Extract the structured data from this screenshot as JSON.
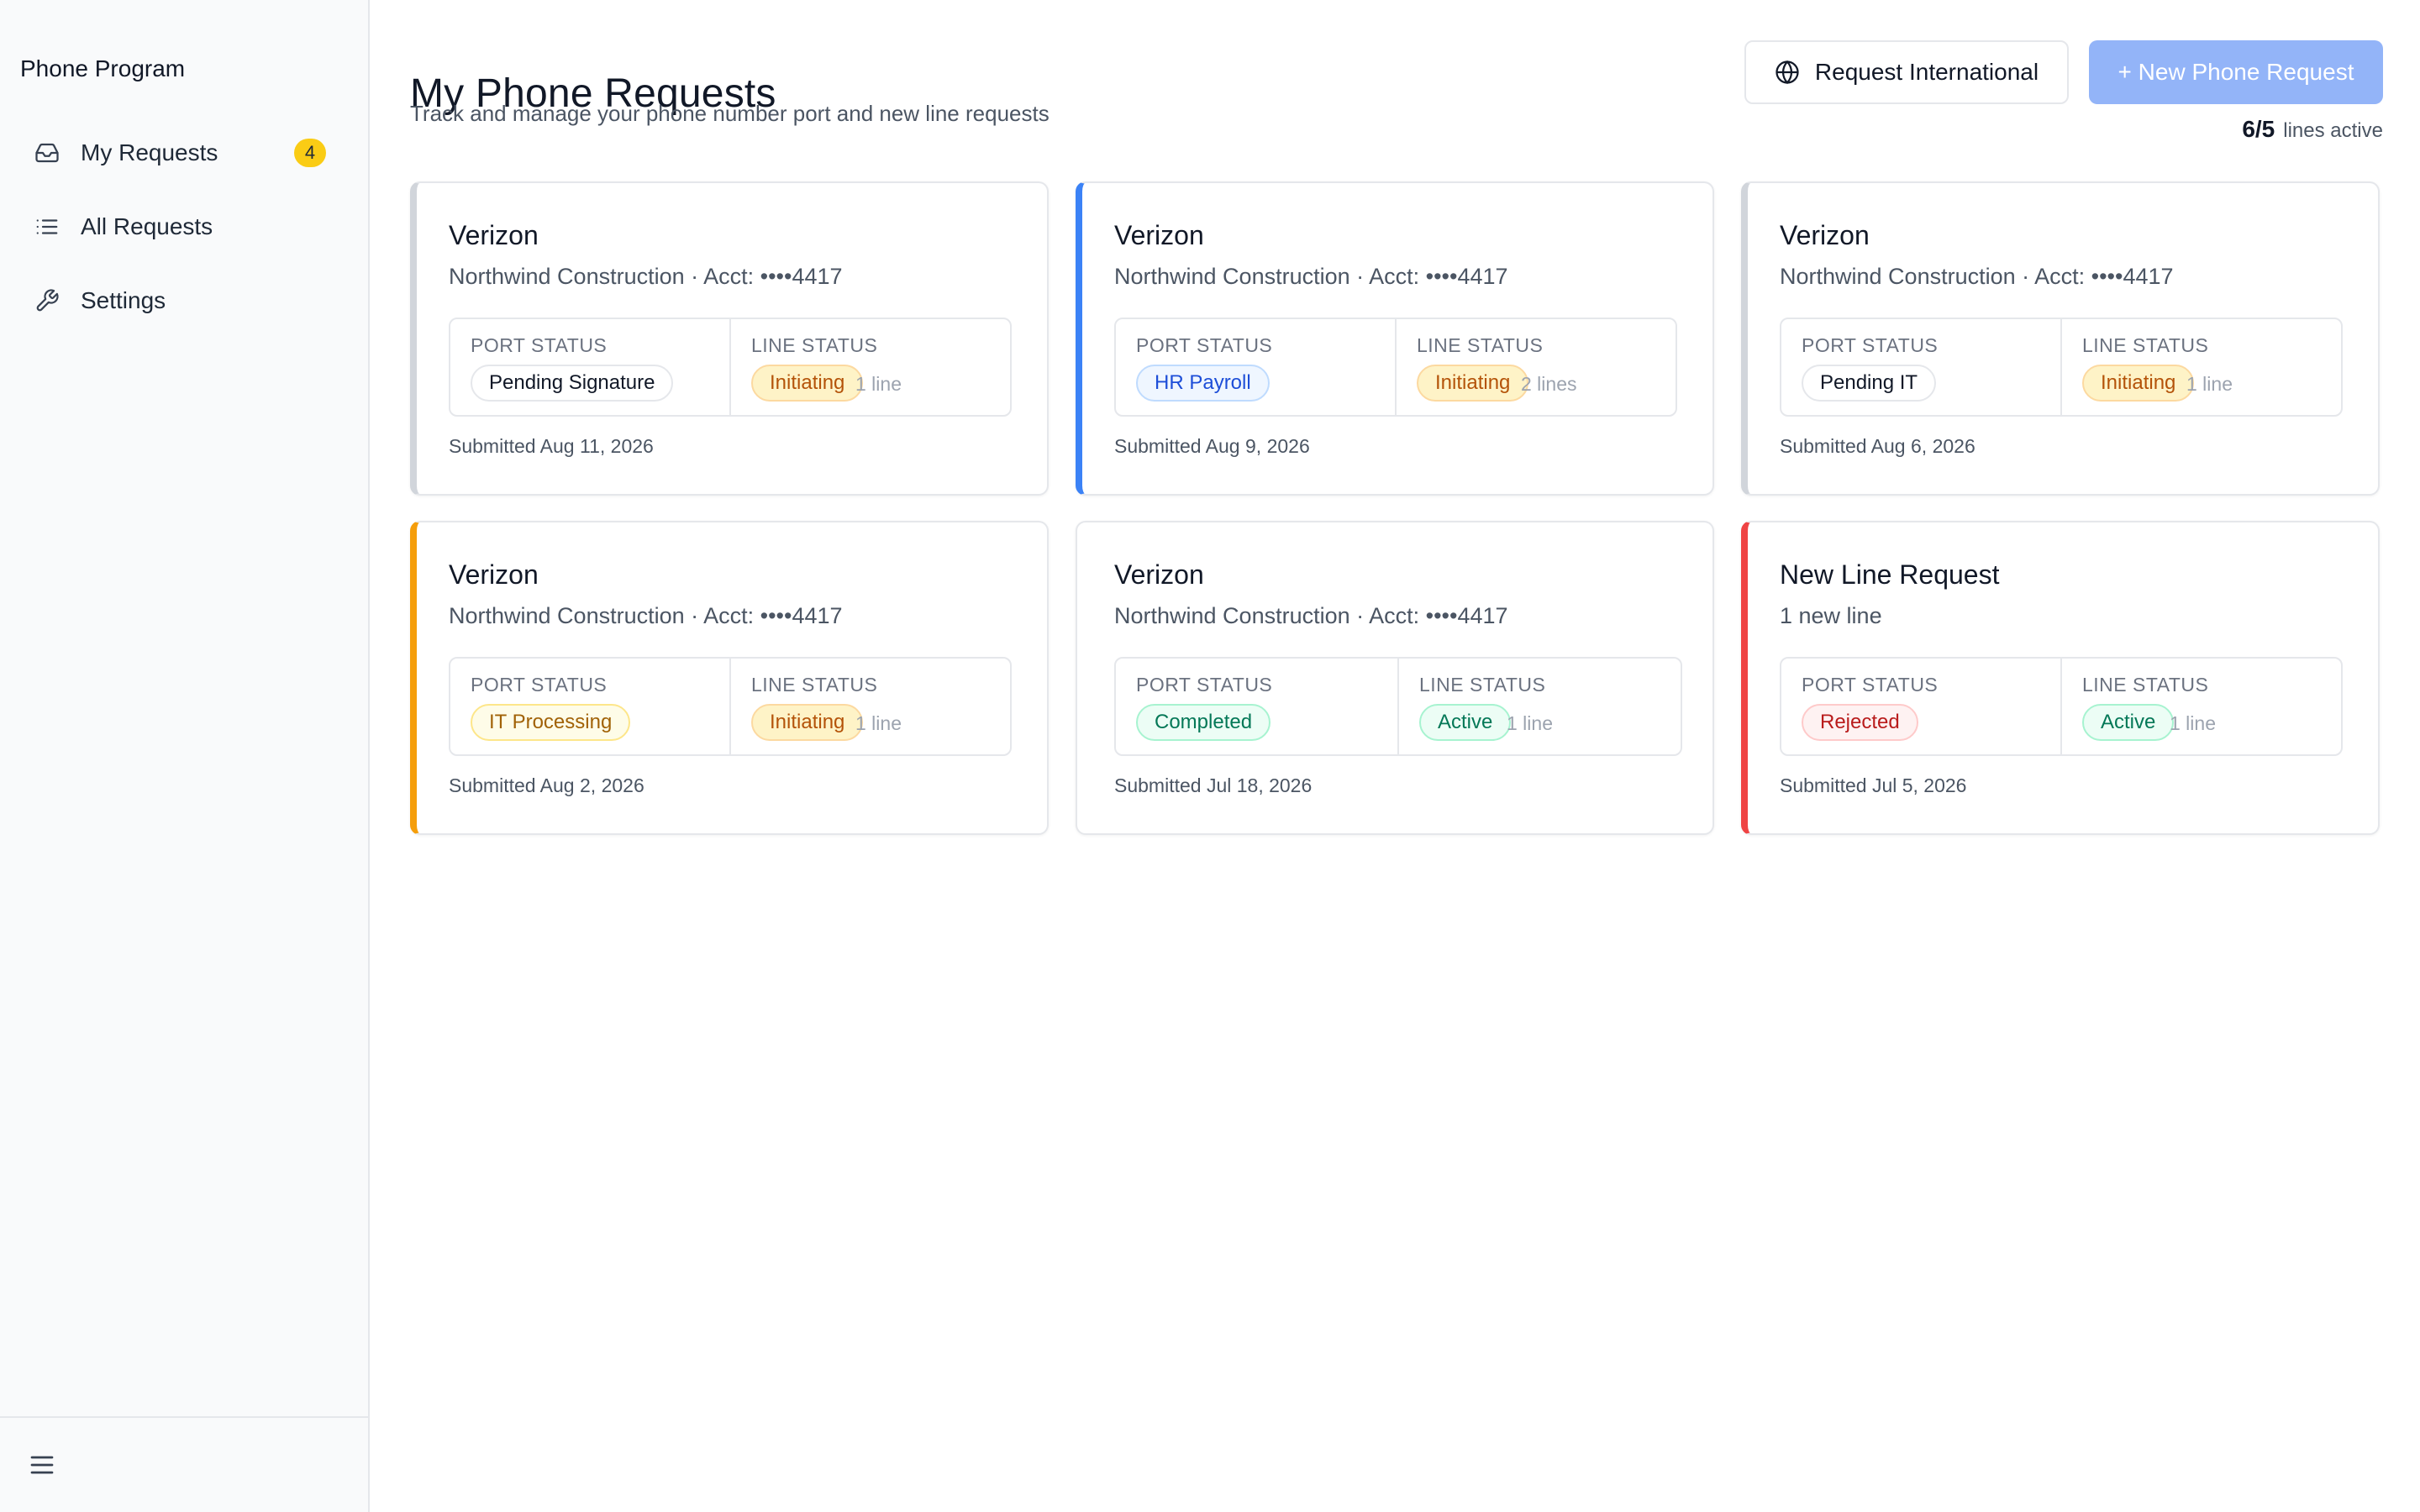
{
  "app": {
    "brand": "Phone Program"
  },
  "sidebar": {
    "items": [
      {
        "label": "My Requests",
        "icon": "inbox-icon",
        "badge": "4"
      },
      {
        "label": "All Requests",
        "icon": "list-icon"
      },
      {
        "label": "Settings",
        "icon": "wrench-icon"
      }
    ],
    "footer_icon": "hamburger-menu-icon"
  },
  "header": {
    "title": "My Phone Requests",
    "subtitle": "Track and manage your phone number port and new line requests",
    "intl_button": "Request International",
    "new_button": "+ New Phone Request",
    "lines_count": "6/5",
    "lines_label": "lines active"
  },
  "labels": {
    "port_status": "PORT STATUS",
    "line_status": "LINE STATUS"
  },
  "colors": {
    "accent_blue": "#3b82f6",
    "accent_orange": "#f59e0b",
    "accent_red": "#ef4444",
    "accent_gray": "#d1d5db",
    "badge_yellow": "#facc15",
    "primary_button": "#93b4f8"
  },
  "cards": [
    {
      "title": "Verizon",
      "subtitle": "Northwind Construction · Acct: ••••4417",
      "port_status": "Pending Signature",
      "port_tone": "neutral",
      "line_status": "Initiating",
      "line_tone": "amber",
      "lines": "1 line",
      "submitted": "Submitted Aug 11, 2026",
      "accent": "gray"
    },
    {
      "title": "Verizon",
      "subtitle": "Northwind Construction · Acct: ••••4417",
      "port_status": "HR Payroll",
      "port_tone": "blue",
      "line_status": "Initiating",
      "line_tone": "amber",
      "lines": "2 lines",
      "submitted": "Submitted Aug 9, 2026",
      "accent": "blue"
    },
    {
      "title": "Verizon",
      "subtitle": "Northwind Construction · Acct: ••••4417",
      "port_status": "Pending IT",
      "port_tone": "neutral",
      "line_status": "Initiating",
      "line_tone": "amber",
      "lines": "1 line",
      "submitted": "Submitted Aug 6, 2026",
      "accent": "gray"
    },
    {
      "title": "Verizon",
      "subtitle": "Northwind Construction · Acct: ••••4417",
      "port_status": "IT Processing",
      "port_tone": "yellow",
      "line_status": "Initiating",
      "line_tone": "amber",
      "lines": "1 line",
      "submitted": "Submitted Aug 2, 2026",
      "accent": "orange"
    },
    {
      "title": "Verizon",
      "subtitle": "Northwind Construction · Acct: ••••4417",
      "port_status": "Completed",
      "port_tone": "green",
      "line_status": "Active",
      "line_tone": "green",
      "lines": "1 line",
      "submitted": "Submitted Jul 18, 2026",
      "accent": "none"
    },
    {
      "title": "New Line Request",
      "subtitle": "1 new line",
      "port_status": "Rejected",
      "port_tone": "red",
      "line_status": "Active",
      "line_tone": "green",
      "lines": "1 line",
      "submitted": "Submitted Jul 5, 2026",
      "accent": "red"
    }
  ]
}
